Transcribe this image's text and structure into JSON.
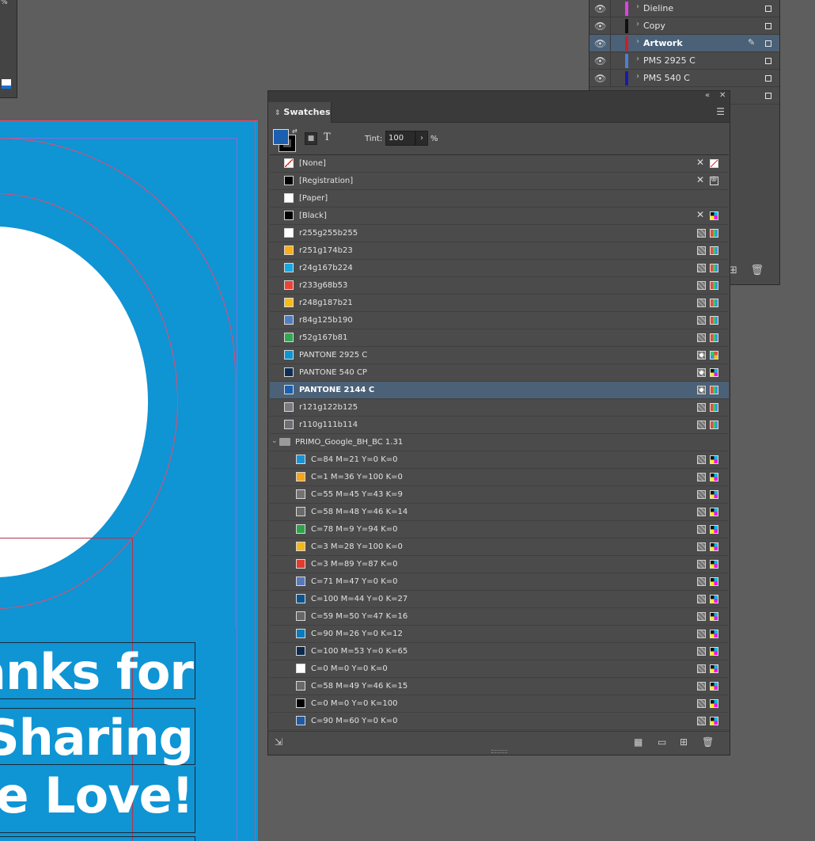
{
  "document": {
    "percent_label": "%",
    "headline_lines": [
      "anks for",
      "Sharing",
      "ne Love!"
    ]
  },
  "layers": [
    {
      "name": "Dieline",
      "color": "#e040e0",
      "selected": false
    },
    {
      "name": "Copy",
      "color": "#111111",
      "selected": false
    },
    {
      "name": "Artwork",
      "color": "#c8202a",
      "selected": true
    },
    {
      "name": "PMS 2925 C",
      "color": "#4a7fd6",
      "selected": false
    },
    {
      "name": "PMS 540 C",
      "color": "#1a1aa8",
      "selected": false
    }
  ],
  "swatches_panel": {
    "tab_label": "Swatches",
    "tint_label": "Tint:",
    "tint_value": "100",
    "tint_unit": "%",
    "colors": {
      "fill": "#1a5fb0",
      "selected_row": "#4b6177"
    },
    "swatches": [
      {
        "name": "[None]",
        "color": "none",
        "i1": "none-lock",
        "i2": "none"
      },
      {
        "name": "[Registration]",
        "color": "#000000",
        "i1": "none-lock",
        "i2": "reg"
      },
      {
        "name": "[Paper]",
        "color": "#ffffff",
        "i1": "",
        "i2": ""
      },
      {
        "name": "[Black]",
        "color": "#000000",
        "i1": "none-lock",
        "i2": "cmyk"
      },
      {
        "name": "r255g255b255",
        "color": "#ffffff",
        "i1": "process",
        "i2": "rgb"
      },
      {
        "name": "r251g174b23",
        "color": "#fbae17",
        "i1": "process",
        "i2": "rgb"
      },
      {
        "name": "r24g167b224",
        "color": "#18a7e0",
        "i1": "process",
        "i2": "rgb"
      },
      {
        "name": "r233g68b53",
        "color": "#e94435",
        "i1": "process",
        "i2": "rgb"
      },
      {
        "name": "r248g187b21",
        "color": "#f8bb15",
        "i1": "process",
        "i2": "rgb"
      },
      {
        "name": "r84g125b190",
        "color": "#547dbe",
        "i1": "process",
        "i2": "rgb"
      },
      {
        "name": "r52g167b81",
        "color": "#34a751",
        "i1": "process",
        "i2": "rgb"
      },
      {
        "name": "PANTONE 2925 C",
        "color": "#0f94d4",
        "i1": "spot",
        "i2": "spotmode"
      },
      {
        "name": "PANTONE 540 CP",
        "color": "#0f2d52",
        "i1": "spot",
        "i2": "cmyk"
      },
      {
        "name": "PANTONE 2144 C",
        "color": "#1a5fb0",
        "i1": "spot",
        "i2": "rgb",
        "selected": true
      },
      {
        "name": "r121g122b125",
        "color": "#797a7d",
        "i1": "process",
        "i2": "rgb"
      },
      {
        "name": "r110g111b114",
        "color": "#6e6f72",
        "i1": "process",
        "i2": "rgb"
      }
    ],
    "group_name": "PRIMO_Google_BH_BC 1.31",
    "group_swatches": [
      {
        "name": "C=84 M=21 Y=0 K=0",
        "color": "#1a92d2"
      },
      {
        "name": "C=1 M=36 Y=100 K=0",
        "color": "#f5a61a"
      },
      {
        "name": "C=55 M=45 Y=43 K=9",
        "color": "#737373"
      },
      {
        "name": "C=58 M=48 Y=46 K=14",
        "color": "#6a6a6a"
      },
      {
        "name": "C=78 M=9 Y=94 K=0",
        "color": "#2ea24a"
      },
      {
        "name": "C=3 M=28 Y=100 K=0",
        "color": "#f6b718"
      },
      {
        "name": "C=3 M=89 Y=87 K=0",
        "color": "#e23b2f"
      },
      {
        "name": "C=71 M=47 Y=0 K=0",
        "color": "#5779bb"
      },
      {
        "name": "C=100 M=44 Y=0 K=27",
        "color": "#0a5590"
      },
      {
        "name": "C=59 M=50 Y=47 K=16",
        "color": "#666666"
      },
      {
        "name": "C=90 M=26 Y=0 K=12",
        "color": "#0a7bbd"
      },
      {
        "name": "C=100 M=53 Y=0 K=65",
        "color": "#0b2a4e"
      },
      {
        "name": "C=0 M=0 Y=0 K=0",
        "color": "#ffffff"
      },
      {
        "name": "C=58 M=49 Y=46 K=15",
        "color": "#696969"
      },
      {
        "name": "C=0 M=0 Y=0 K=100",
        "color": "#000000"
      },
      {
        "name": "C=90 M=60 Y=0 K=0",
        "color": "#1f5aa8"
      }
    ]
  }
}
